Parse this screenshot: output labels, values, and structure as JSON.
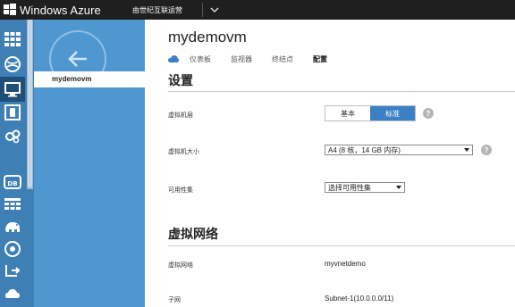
{
  "topbar": {
    "brand": "Windows Azure",
    "subscription": "由世纪互联运营",
    "brand_color": "#1f1f1f"
  },
  "rail": {
    "items": [
      {
        "icon": "all-items-grid-icon"
      },
      {
        "icon": "web-sites-icon"
      },
      {
        "icon": "virtual-machines-icon"
      },
      {
        "icon": "mobile-services-icon"
      },
      {
        "icon": "cloud-services-icon"
      },
      {
        "icon": "sql-databases-icon"
      },
      {
        "icon": "storage-icon"
      },
      {
        "icon": "hdinsight-icon"
      },
      {
        "icon": "media-services-icon"
      },
      {
        "icon": "service-bus-icon"
      },
      {
        "icon": "networks-icon"
      }
    ],
    "accent": "#3e7fb5"
  },
  "nav": {
    "selected_item": "mydemovm",
    "accent": "#4f97cf"
  },
  "main": {
    "title": "mydemovm",
    "tabs": [
      {
        "label": "仪表板"
      },
      {
        "label": "监视器"
      },
      {
        "label": "终结点"
      },
      {
        "label": "配置"
      }
    ],
    "settings_heading": "设置",
    "tier": {
      "label": "虚拟机层",
      "options": [
        "基本",
        "标准"
      ],
      "selected": "标准"
    },
    "size": {
      "label": "虚拟机大小",
      "value": "A4 (8 核，14 GB 内存)"
    },
    "availability": {
      "label": "可用性集",
      "value": "选择可用性集"
    },
    "network_heading": "虚拟网络",
    "vnet": {
      "label": "虚拟网络",
      "value": "myvnetdemo"
    },
    "subnet": {
      "label": "子网",
      "value": "Subnet-1(10.0.0.0/11)"
    },
    "help_glyph": "?",
    "selected_color": "#3b80c4"
  }
}
